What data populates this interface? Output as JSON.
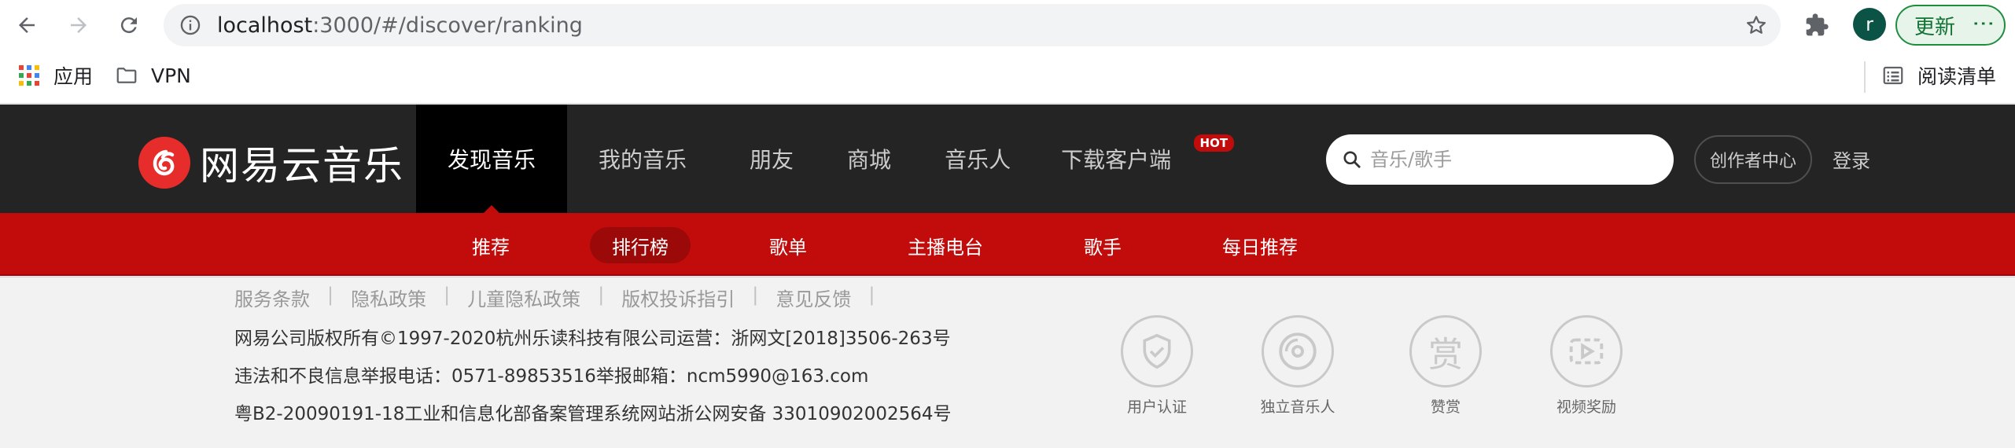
{
  "browser": {
    "url_host": "localhost",
    "url_rest": ":3000/#/discover/ranking",
    "profile_initial": "r",
    "update_label": "更新",
    "update_menu": "⋮"
  },
  "bookmarks": {
    "apps_label": "应用",
    "vpn_label": "VPN",
    "reading_list_label": "阅读清单"
  },
  "header": {
    "logo_text": "网易云音乐",
    "nav": [
      "发现音乐",
      "我的音乐",
      "朋友",
      "商城",
      "音乐人",
      "下载客户端"
    ],
    "hot_badge": "HOT",
    "search_placeholder": "音乐/歌手",
    "creator_label": "创作者中心",
    "login_label": "登录"
  },
  "subnav": [
    "推荐",
    "排行榜",
    "歌单",
    "主播电台",
    "歌手",
    "每日推荐"
  ],
  "footer": {
    "links": [
      "服务条款",
      "隐私政策",
      "儿童隐私政策",
      "版权投诉指引",
      "意见反馈"
    ],
    "separator": "|",
    "line1": "网易公司版权所有©1997-2020杭州乐读科技有限公司运营：浙网文[2018]3506-263号",
    "line2": "违法和不良信息举报电话：0571-89853516举报邮箱：ncm5990@163.com",
    "line3": "粤B2-20090191-18工业和信息化部备案管理系统网站浙公网安备 33010902002564号",
    "badges": [
      "用户认证",
      "独立音乐人",
      "赞赏",
      "视频奖励"
    ],
    "reward_glyph": "赏"
  }
}
